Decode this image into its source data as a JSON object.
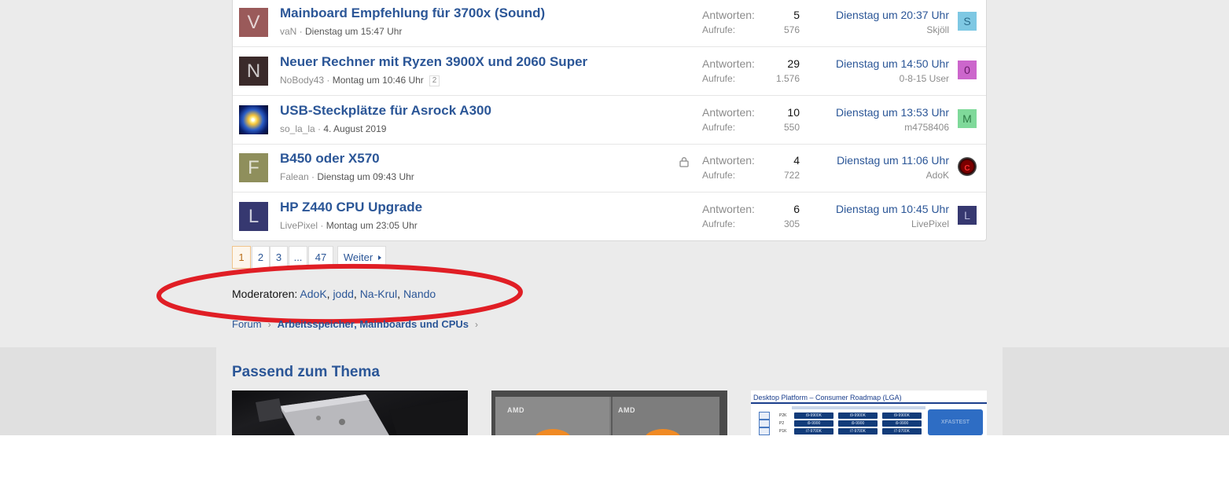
{
  "threads": [
    {
      "avatar_letter": "V",
      "avatar_color": "#9a5a5a",
      "title": "Mainboard Empfehlung für 3700x (Sound)",
      "author": "vaN",
      "start_date": "Dienstag um 15:47 Uhr",
      "pages": "",
      "locked": false,
      "replies_label": "Antworten:",
      "replies": "5",
      "views_label": "Aufrufe:",
      "views": "576",
      "last_date": "Dienstag um 20:37 Uhr",
      "last_user": "Skjöll",
      "last_avatar_letter": "S",
      "last_avatar_color": "#7ec8e3",
      "last_avatar_text_color": "#2a6b8a"
    },
    {
      "avatar_letter": "N",
      "avatar_color": "#3a2a2a",
      "title": "Neuer Rechner mit Ryzen 3900X und 2060 Super",
      "author": "NoBody43",
      "start_date": "Montag um 10:46 Uhr",
      "pages": "2",
      "locked": false,
      "replies_label": "Antworten:",
      "replies": "29",
      "views_label": "Aufrufe:",
      "views": "1.576",
      "last_date": "Dienstag um 14:50 Uhr",
      "last_user": "0-8-15 User",
      "last_avatar_letter": "0",
      "last_avatar_color": "#cc66cc",
      "last_avatar_text_color": "#6a1a6a"
    },
    {
      "avatar_letter": "",
      "avatar_color": "#0a1f6b",
      "title": "USB-Steckplätze für Asrock A300",
      "author": "so_la_la",
      "start_date": "4. August 2019",
      "pages": "",
      "locked": false,
      "replies_label": "Antworten:",
      "replies": "10",
      "views_label": "Aufrufe:",
      "views": "550",
      "last_date": "Dienstag um 13:53 Uhr",
      "last_user": "m4758406",
      "last_avatar_letter": "M",
      "last_avatar_color": "#7fd99a",
      "last_avatar_text_color": "#2c7a45"
    },
    {
      "avatar_letter": "F",
      "avatar_color": "#8f8f5c",
      "title": "B450 oder X570",
      "author": "Falean",
      "start_date": "Dienstag um 09:43 Uhr",
      "pages": "",
      "locked": true,
      "replies_label": "Antworten:",
      "replies": "4",
      "views_label": "Aufrufe:",
      "views": "722",
      "last_date": "Dienstag um 11:06 Uhr",
      "last_user": "AdoK",
      "last_avatar_letter": "C",
      "last_avatar_color": "#7a0000",
      "last_avatar_text_color": "#ff3030"
    },
    {
      "avatar_letter": "L",
      "avatar_color": "#363870",
      "title": "HP Z440 CPU Upgrade",
      "author": "LivePixel",
      "start_date": "Montag um 23:05 Uhr",
      "pages": "",
      "locked": false,
      "replies_label": "Antworten:",
      "replies": "6",
      "views_label": "Aufrufe:",
      "views": "305",
      "last_date": "Dienstag um 10:45 Uhr",
      "last_user": "LivePixel",
      "last_avatar_letter": "L",
      "last_avatar_color": "#363870",
      "last_avatar_text_color": "#b8badd"
    }
  ],
  "pagination": {
    "pages": [
      "1",
      "2",
      "3",
      "...",
      "47"
    ],
    "current": "1",
    "next_label": "Weiter"
  },
  "moderators": {
    "label": "Moderatoren:",
    "names": [
      "AdoK",
      "jodd",
      "Na-Krul",
      "Nando"
    ]
  },
  "breadcrumb": {
    "items": [
      "Forum",
      "Arbeitsspeicher, Mainboards und CPUs"
    ]
  },
  "related": {
    "title": "Passend zum Thema",
    "thumb2_logo": "AMD",
    "thumb3_title": "Desktop Platform – Consumer Roadmap (LGA)",
    "thumb3_watermark": "XFASTEST",
    "thumb3_rows": [
      "P2K",
      "P2",
      "P1K"
    ],
    "thumb3_chips": [
      "i9-9900K",
      "i9-9900K",
      "i9-9900K",
      "i9-9900",
      "i9-9900",
      "i9-9900",
      "i7-9700K",
      "i7-9700K",
      "i7-9700K"
    ]
  },
  "colors": {
    "accent": "#2b5697",
    "muted": "#8c8c8c",
    "highlight_ellipse": "#e01e25",
    "page_bg": "#ebebeb"
  }
}
